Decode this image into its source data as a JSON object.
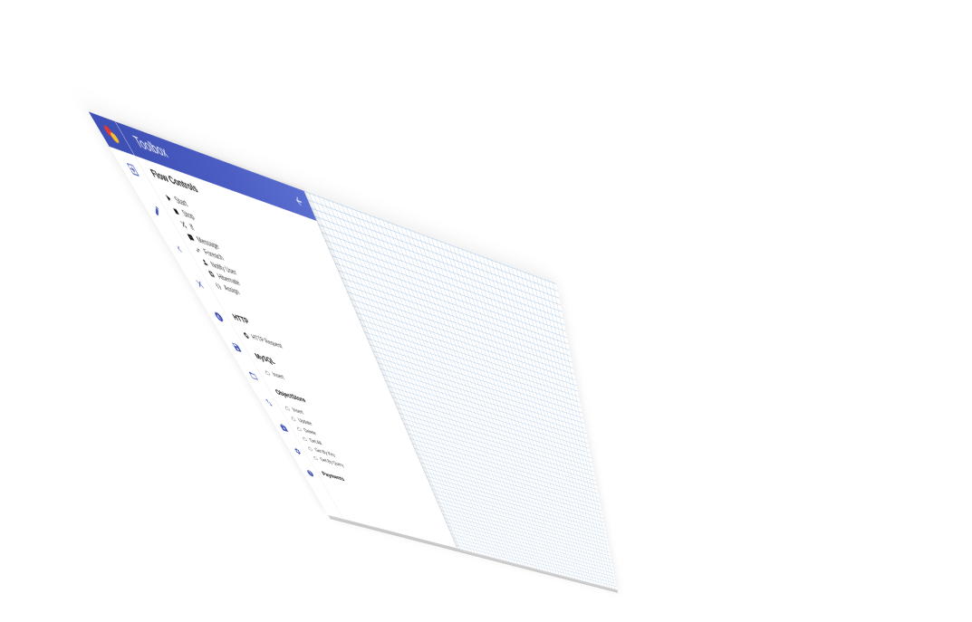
{
  "toolbox": {
    "title": "Toolbox",
    "back_icon": "arrow-left-icon"
  },
  "rail": {
    "logo": "app-logo",
    "buttons": [
      {
        "name": "import-button",
        "icon": "import-icon"
      },
      {
        "name": "edit-button",
        "icon": "pencil-icon"
      },
      {
        "name": "collapse-button",
        "icon": "chevron-left-icon"
      },
      {
        "name": "close-button",
        "icon": "close-icon"
      },
      {
        "name": "euro-button",
        "icon": "euro-icon"
      },
      {
        "name": "save-button",
        "icon": "floppy-disk-icon"
      },
      {
        "name": "open-folder-button",
        "icon": "folder-icon"
      },
      {
        "name": "swap-button",
        "icon": "swap-vertical-icon"
      },
      {
        "name": "medkit-button",
        "icon": "medkit-icon"
      },
      {
        "name": "settings-button",
        "icon": "gear-icon"
      },
      {
        "name": "help-button",
        "icon": "help-circle-icon"
      }
    ]
  },
  "sections": {
    "flow": {
      "title": "Flow Controls",
      "items": [
        {
          "label": "Start",
          "icon": "play-icon"
        },
        {
          "label": "Stop",
          "icon": "stop-icon"
        },
        {
          "label": "If",
          "icon": "shuffle-icon"
        },
        {
          "label": "Message",
          "icon": "message-icon"
        },
        {
          "label": "Foreach",
          "icon": "swap-icon"
        },
        {
          "label": "Notify User",
          "icon": "user-icon"
        },
        {
          "label": "Hibernate",
          "icon": "lifebuoy-icon"
        },
        {
          "label": "Assign",
          "icon": "assign-icon"
        }
      ]
    },
    "http": {
      "title": "HTTP",
      "items": [
        {
          "label": "HTTP Request",
          "icon": "globe-icon"
        }
      ]
    },
    "mysql": {
      "title": "MySQL",
      "items": [
        {
          "label": "Insert",
          "icon": "cloud-icon"
        }
      ]
    },
    "objectstore": {
      "title": "ObjectStore",
      "items": [
        {
          "label": "Insert",
          "icon": "cloud-icon"
        },
        {
          "label": "Update",
          "icon": "cloud-icon"
        },
        {
          "label": "Delete",
          "icon": "cloud-icon"
        },
        {
          "label": "Get All",
          "icon": "cloud-icon"
        },
        {
          "label": "Get By Key",
          "icon": "cloud-icon"
        },
        {
          "label": "Get By Query",
          "icon": "cloud-icon"
        }
      ]
    },
    "payments": {
      "title": "Payments"
    }
  },
  "colors": {
    "primary": "#3f51b5",
    "grid_line": "#8cb4dc",
    "edge": "#c8c8c8"
  }
}
